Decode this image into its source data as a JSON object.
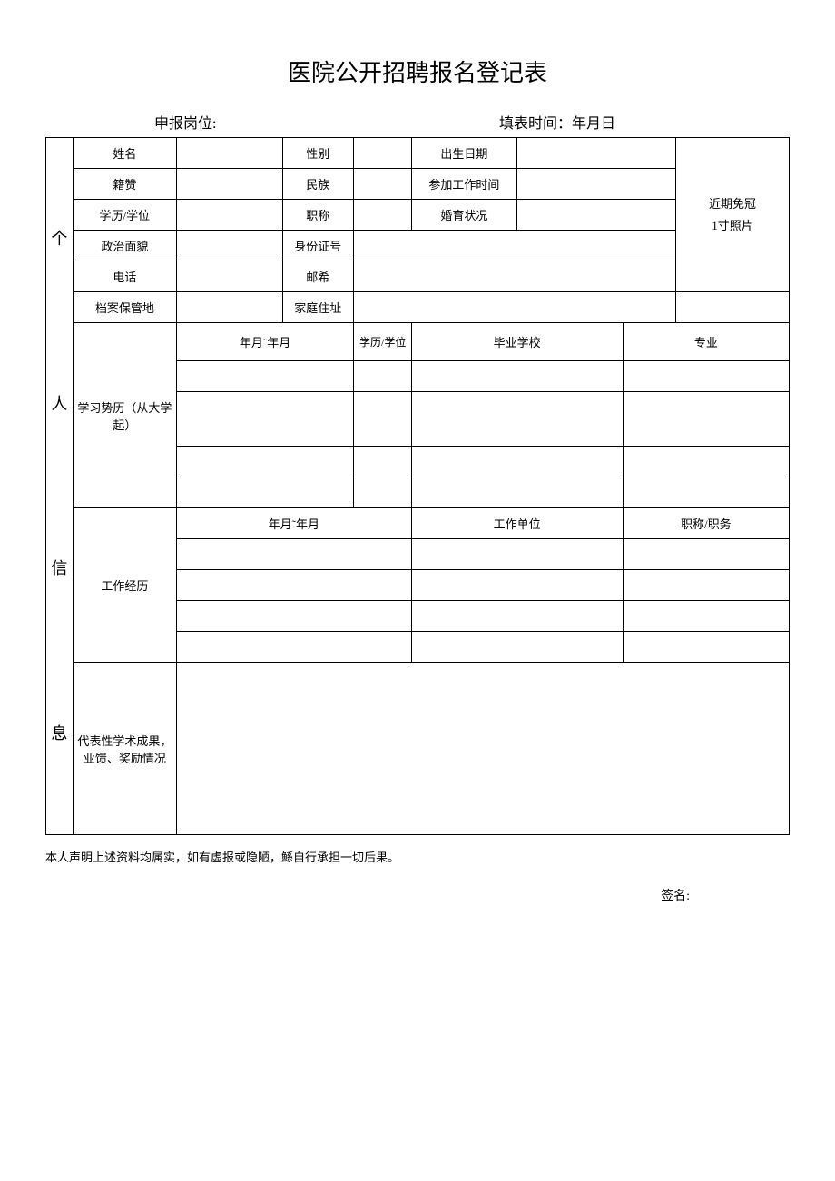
{
  "title": "医院公开招聘报名登记表",
  "header": {
    "position_label": "申报岗位:",
    "fill_time_label": "填表时间：年月日"
  },
  "side_label": {
    "c1": "个",
    "c2": "人",
    "c3": "信",
    "c4": "息"
  },
  "rows": {
    "r1": {
      "name": "姓名",
      "gender": "性别",
      "birth": "出生日期"
    },
    "r2": {
      "native": "籍赞",
      "ethnic": "民族",
      "work_start": "参加工作时间"
    },
    "r3": {
      "education": "学历/学位",
      "title": "职称",
      "marriage": "婚育状况"
    },
    "r4": {
      "political": "政治面貌",
      "id": "身份证号"
    },
    "r5": {
      "phone": "电话",
      "email": "邮希"
    },
    "r6": {
      "archive": "档案保管地",
      "address": "家庭住址"
    }
  },
  "photo_label": "近期免冠\n1寸照片",
  "photo_label_l1": "近期免冠",
  "photo_label_l2": "1寸照片",
  "education_section": {
    "label": "学习势历（从大学起）",
    "col1": "年月˜年月",
    "col2": "学历/学位",
    "col3": "毕业学校",
    "col4": "专业"
  },
  "work_section": {
    "label": "工作经历",
    "col1": "年月˜年月",
    "col2": "工作单位",
    "col3": "职称/职务"
  },
  "achievements_label": "代表性学术成果，业馈、奖励情况",
  "declaration": "本人声明上述资料均属实，如有虚报或隐陋，鯀自行承担一切后果。",
  "signature_label": "签名:"
}
